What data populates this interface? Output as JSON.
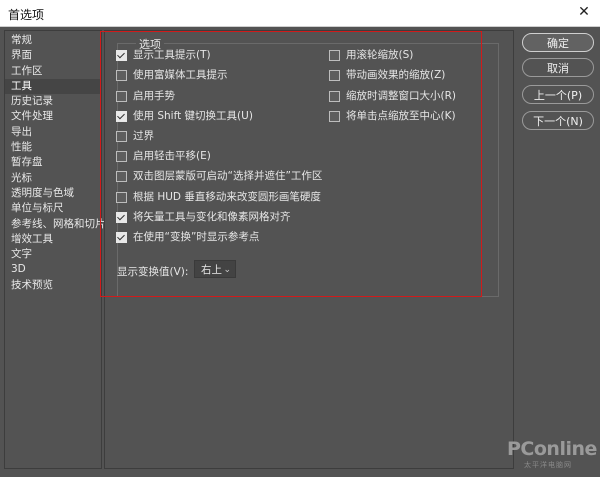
{
  "window": {
    "title": "首选项",
    "close_icon": "close-icon"
  },
  "sidebar": {
    "items": [
      {
        "label": "常规"
      },
      {
        "label": "界面"
      },
      {
        "label": "工作区"
      },
      {
        "label": "工具",
        "selected": true
      },
      {
        "label": "历史记录"
      },
      {
        "label": "文件处理"
      },
      {
        "label": "导出"
      },
      {
        "label": "性能"
      },
      {
        "label": "暂存盘"
      },
      {
        "label": "光标"
      },
      {
        "label": "透明度与色域"
      },
      {
        "label": "单位与标尺"
      },
      {
        "label": "参考线、网格和切片"
      },
      {
        "label": "增效工具"
      },
      {
        "label": "文字"
      },
      {
        "label": "3D"
      },
      {
        "label": "技术预览"
      }
    ]
  },
  "options": {
    "group_label": "选项",
    "left": [
      {
        "label": "显示工具提示(T)",
        "checked": true
      },
      {
        "label": "使用富媒体工具提示",
        "checked": false
      },
      {
        "label": "启用手势",
        "checked": false
      },
      {
        "label": "使用 Shift 键切换工具(U)",
        "checked": true
      },
      {
        "label": "过界",
        "checked": false
      },
      {
        "label": "启用轻击平移(E)",
        "checked": false
      },
      {
        "label": "双击图层蒙版可启动“选择并遮住”工作区",
        "checked": false
      },
      {
        "label": "根据 HUD 垂直移动来改变圆形画笔硬度",
        "checked": false
      },
      {
        "label": "将矢量工具与变化和像素网格对齐",
        "checked": true
      },
      {
        "label": "在使用“变换”时显示参考点",
        "checked": true
      }
    ],
    "right": [
      {
        "label": "用滚轮缩放(S)",
        "checked": false
      },
      {
        "label": "带动画效果的缩放(Z)",
        "checked": false
      },
      {
        "label": "缩放时调整窗口大小(R)",
        "checked": false
      },
      {
        "label": "将单击点缩放至中心(K)",
        "checked": false
      }
    ],
    "display_transform_label": "显示变换值(V):",
    "display_transform_value": "右上"
  },
  "buttons": {
    "ok": "确定",
    "cancel": "取消",
    "prev": "上一个(P)",
    "next": "下一个(N)"
  },
  "watermark": {
    "brand": "PConline",
    "sub": "太平洋电脑网"
  },
  "colors": {
    "background": "#535353",
    "highlight": "#d11b1b"
  }
}
